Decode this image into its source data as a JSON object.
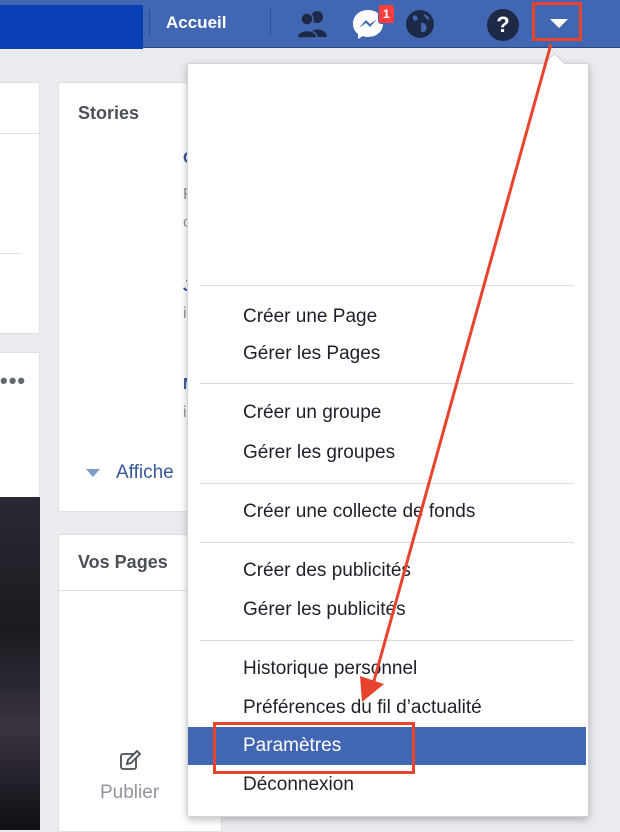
{
  "header": {
    "home_label": "Accueil",
    "messages_badge": "1",
    "help_glyph": "?",
    "icons": [
      "friends-icon",
      "messenger-icon",
      "globe-icon",
      "help-icon",
      "dropdown-caret-icon"
    ],
    "bar_color": "#4267b2"
  },
  "background": {
    "stories_title": "Stories",
    "peek_letters": [
      "C",
      "F",
      "c",
      "J",
      "i",
      "M",
      "i"
    ],
    "show_more_label": "Affiche",
    "pages_title": "Vos Pages",
    "publish_label": "Publier",
    "dots": "•••"
  },
  "menu": {
    "groups": [
      [
        "Créer une Page",
        "Gérer les Pages"
      ],
      [
        "Créer un groupe",
        "Gérer les groupes"
      ],
      [
        "Créer une collecte de fonds"
      ],
      [
        "Créer des publicités",
        "Gérer les publicités"
      ],
      [
        "Historique personnel",
        "Préférences du fil d’actualité",
        "Paramètres",
        "Déconnexion"
      ]
    ],
    "active_item": "Paramètres",
    "highlight_color": "#4267b2",
    "annotation_color": "#e8442d"
  }
}
